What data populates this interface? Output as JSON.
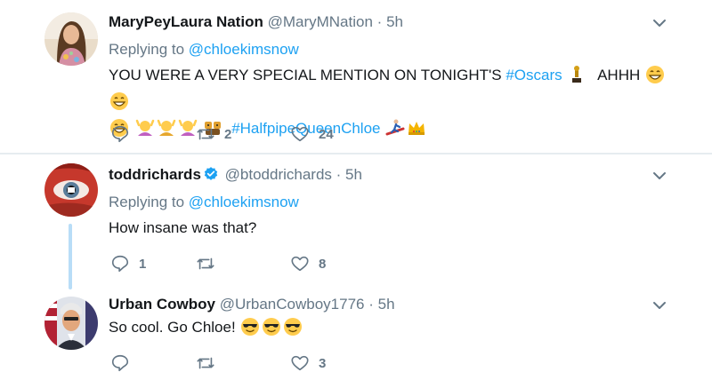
{
  "tweets": [
    {
      "name": "MaryPeyLaura Nation",
      "handle": "@MaryMNation",
      "separator": "·",
      "time": "5h",
      "replying_label": "Replying to",
      "replying_to": "@chloekimsnow",
      "text_1": "YOU WERE A VERY SPECIAL MENTION ON TONIGHT'S",
      "hashtag_1": "#Oscars",
      "text_2": "AHHH",
      "hashtag_2": "#HalfpipeQueenChloe",
      "emoji_line_1": [
        "trophy",
        "grin",
        "grin"
      ],
      "emoji_line_2": [
        "grin",
        "person-pink",
        "person-gold",
        "person-pink",
        "bear-faces"
      ],
      "emoji_after_tag": [
        "snowboarder",
        "crown"
      ],
      "replies": "",
      "retweets": "2",
      "likes": "24"
    },
    {
      "name": "toddrichards",
      "verified": true,
      "handle": "@btoddrichards",
      "separator": "·",
      "time": "5h",
      "replying_label": "Replying to",
      "replying_to": "@chloekimsnow",
      "text": "How insane was that?",
      "replies": "1",
      "retweets": "",
      "likes": "8"
    },
    {
      "name": "Urban Cowboy",
      "handle": "@UrbanCowboy1776",
      "separator": "·",
      "time": "5h",
      "text": "So cool. Go Chloe!",
      "emoji": [
        "sunglasses",
        "sunglasses",
        "sunglasses"
      ],
      "replies": "",
      "retweets": "",
      "likes": "3"
    }
  ],
  "icons": {
    "reply": "reply-icon",
    "retweet": "retweet-icon",
    "like": "heart-icon",
    "menu": "chevron-down-icon",
    "verified": "verified-badge-icon"
  },
  "colors": {
    "link": "#1da1f2",
    "muted": "#657786",
    "text": "#14171a",
    "thread_line": "#b8ddf7",
    "divider": "#e6ecf0"
  }
}
